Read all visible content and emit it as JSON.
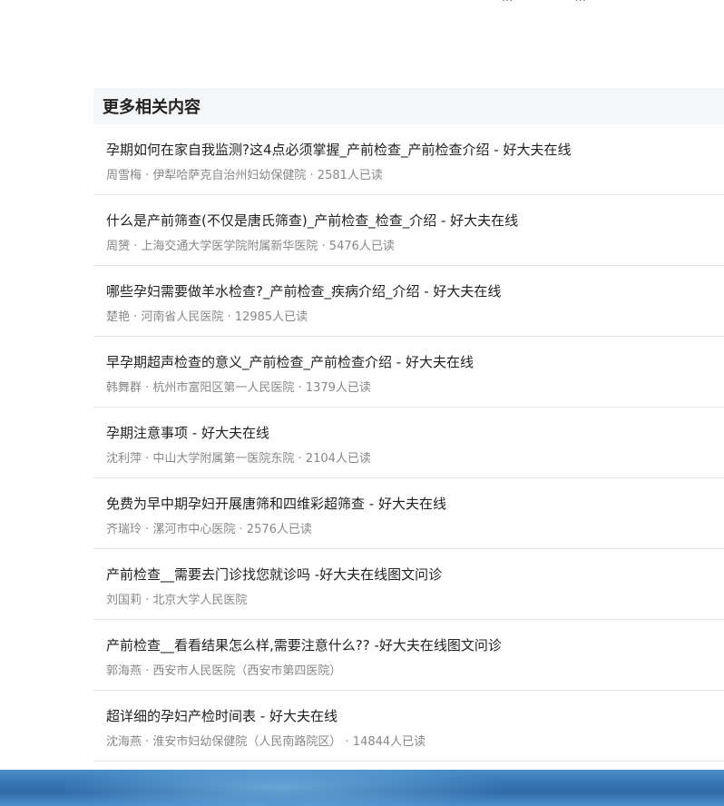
{
  "top_partial": [
    "...",
    "..."
  ],
  "section_title": "更多相关内容",
  "items": [
    {
      "title": "孕期如何在家自我监测?这4点必须掌握_产前检查_产前检查介绍 - 好大夫在线",
      "meta": "周雪梅 · 伊犁哈萨克自治州妇幼保健院 · 2581人已读"
    },
    {
      "title": "什么是产前筛查(不仅是唐氏筛查)_产前检查_检查_介绍 - 好大夫在线",
      "meta": "周赟 · 上海交通大学医学院附属新华医院 · 5476人已读"
    },
    {
      "title": "哪些孕妇需要做羊水检查?_产前检查_疾病介绍_介绍 - 好大夫在线",
      "meta": "楚艳 · 河南省人民医院 · 12985人已读"
    },
    {
      "title": "早孕期超声检查的意义_产前检查_产前检查介绍 - 好大夫在线",
      "meta": "韩舞群 · 杭州市富阳区第一人民医院 · 1379人已读"
    },
    {
      "title": "孕期注意事项 - 好大夫在线",
      "meta": "沈利萍 · 中山大学附属第一医院东院 · 2104人已读"
    },
    {
      "title": "免费为早中期孕妇开展唐筛和四维彩超筛查 - 好大夫在线",
      "meta": "齐瑞玲 · 漯河市中心医院 · 2576人已读"
    },
    {
      "title": "产前检查__需要去门诊找您就诊吗 -好大夫在线图文问诊",
      "meta": "刘国莉 · 北京大学人民医院"
    },
    {
      "title": "产前检查__看看结果怎么样,需要注意什么?? -好大夫在线图文问诊",
      "meta": "郭海燕 · 西安市人民医院（西安市第四医院）"
    },
    {
      "title": "超详细的孕妇产检时间表 - 好大夫在线",
      "meta": "沈海燕 · 淮安市妇幼保健院（人民南路院区） · 14844人已读"
    }
  ]
}
